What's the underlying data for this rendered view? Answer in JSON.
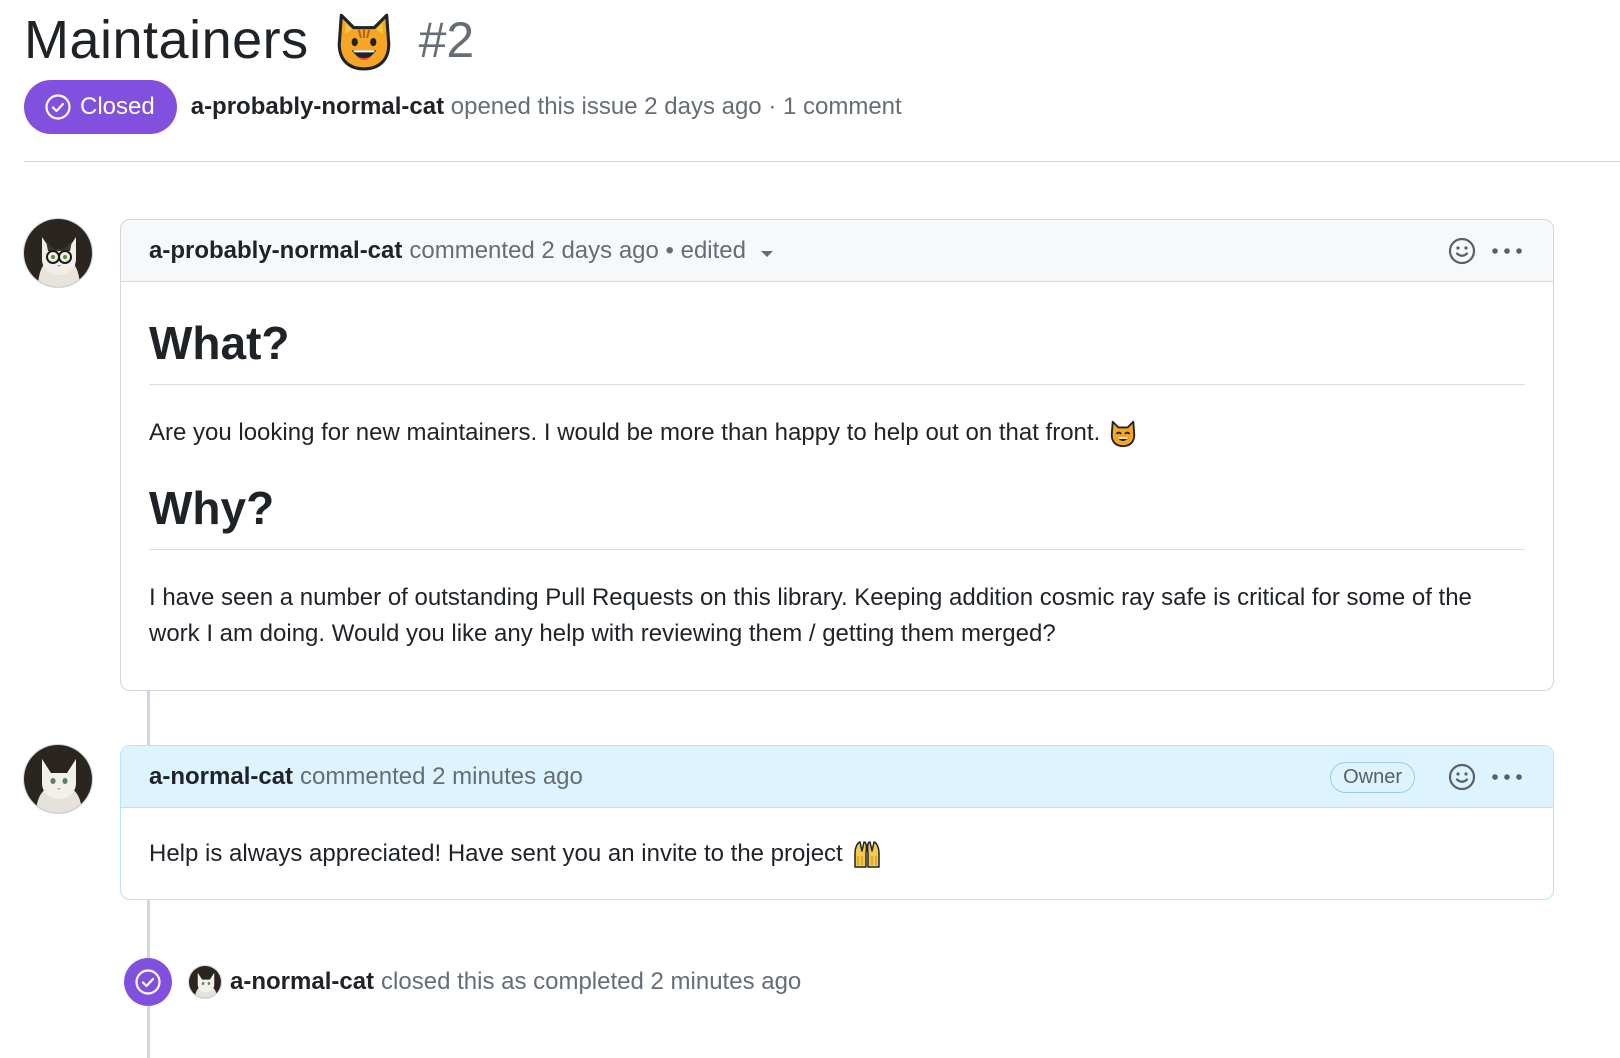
{
  "issue": {
    "title": "Maintainers",
    "title_emoji": "grinning-cat-emoji",
    "number": "#2",
    "state": "Closed",
    "author": "a-probably-normal-cat",
    "opened_text": "opened this issue 2 days ago · 1 comment"
  },
  "comments": [
    {
      "author": "a-probably-normal-cat",
      "meta": "commented 2 days ago • edited",
      "heading_1": "What?",
      "paragraph_1": "Are you looking for new maintainers. I would be more than happy to help out on that front.",
      "heading_2": "Why?",
      "paragraph_2": "I have seen a number of outstanding Pull Requests on this library. Keeping addition cosmic ray safe is critical for some of the work I am doing. Would you like any help with reviewing them / getting them merged?"
    },
    {
      "author": "a-normal-cat",
      "meta": "commented 2 minutes ago",
      "badge": "Owner",
      "body": "Help is always appreciated! Have sent you an invite to the project"
    }
  ],
  "close_event": {
    "actor": "a-normal-cat",
    "text": "closed this as completed 2 minutes ago"
  },
  "colors": {
    "closed_purple": "#8250df",
    "owner_header": "#ddf4ff",
    "muted_text": "#656d76"
  }
}
